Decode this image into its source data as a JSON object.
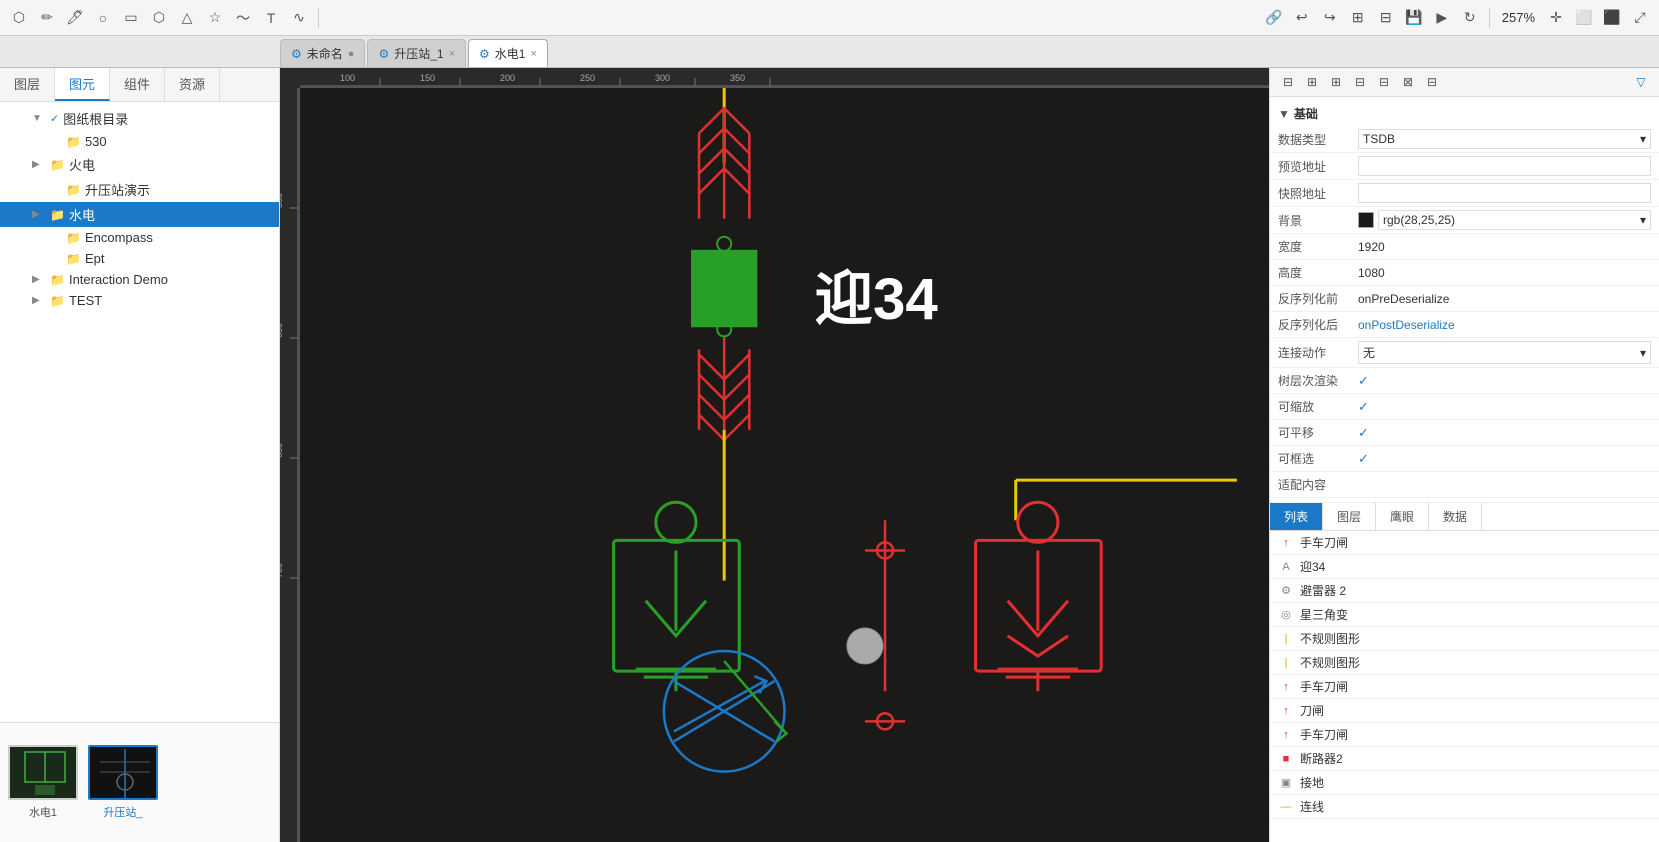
{
  "topToolbar": {
    "icons": [
      "select",
      "pencil",
      "pen",
      "circle",
      "rectangle",
      "hexagon",
      "triangle",
      "star",
      "curve",
      "text",
      "wave"
    ],
    "rightIcons": [
      "link",
      "undo",
      "redo",
      "grid",
      "align",
      "save",
      "play",
      "refresh"
    ],
    "zoom": "257%",
    "moreIcons": [
      "crosshair",
      "window",
      "maxwindow",
      "fullscreen"
    ]
  },
  "tabs": [
    {
      "id": "unnamed",
      "label": "未命名",
      "icon": "⚙",
      "active": false,
      "closable": false
    },
    {
      "id": "substation1",
      "label": "升压站_1",
      "icon": "⚙",
      "active": false,
      "closable": true
    },
    {
      "id": "hydro1",
      "label": "水电1",
      "icon": "⚙",
      "active": true,
      "closable": true
    }
  ],
  "sidebar": {
    "tabs": [
      "图层",
      "图元",
      "组件",
      "资源"
    ],
    "activeTab": "图层",
    "tree": [
      {
        "id": "root",
        "label": "图纸根目录",
        "indent": 0,
        "expand": true,
        "icon": "check",
        "hasCheck": true
      },
      {
        "id": "530",
        "label": "530",
        "indent": 1,
        "icon": "folder"
      },
      {
        "id": "hydro-power",
        "label": "火电",
        "indent": 1,
        "icon": "folder",
        "expand": true
      },
      {
        "id": "substation-demo",
        "label": "升压站演示",
        "indent": 2,
        "icon": "folder"
      },
      {
        "id": "water-power",
        "label": "水电",
        "indent": 1,
        "icon": "folder",
        "active": true
      },
      {
        "id": "encompass",
        "label": "Encompass",
        "indent": 2,
        "icon": "folder"
      },
      {
        "id": "ept",
        "label": "Ept",
        "indent": 2,
        "icon": "folder"
      },
      {
        "id": "interaction-demo",
        "label": "Interaction Demo",
        "indent": 1,
        "icon": "folder",
        "expand": false
      },
      {
        "id": "test",
        "label": "TEST",
        "indent": 1,
        "icon": "folder",
        "expand": false
      }
    ],
    "thumbnails": [
      {
        "id": "thumb1",
        "label": "水电1",
        "active": false
      },
      {
        "id": "thumb2",
        "label": "升压站_",
        "active": true
      }
    ]
  },
  "properties": {
    "sectionLabel": "基础",
    "rows": [
      {
        "key": "dataType",
        "label": "数据类型",
        "value": "TSDB",
        "type": "select"
      },
      {
        "key": "previewUrl",
        "label": "预览地址",
        "value": "",
        "type": "input"
      },
      {
        "key": "snapshotUrl",
        "label": "快照地址",
        "value": "",
        "type": "input"
      },
      {
        "key": "background",
        "label": "背景",
        "value": "rgb(28,25,25)",
        "color": "#1c1919",
        "type": "color-select"
      },
      {
        "key": "width",
        "label": "宽度",
        "value": "1920",
        "type": "text"
      },
      {
        "key": "height",
        "label": "高度",
        "value": "1080",
        "type": "text"
      },
      {
        "key": "preDeserialize",
        "label": "反序列化前",
        "value": "onPreDeserialize",
        "type": "text"
      },
      {
        "key": "postDeserialize",
        "label": "反序列化后",
        "value": "onPostDeserialize",
        "type": "link"
      },
      {
        "key": "connectAction",
        "label": "连接动作",
        "value": "无",
        "type": "select"
      },
      {
        "key": "treeRender",
        "label": "树层次渲染",
        "value": "✓",
        "type": "check"
      },
      {
        "key": "scalable",
        "label": "可缩放",
        "value": "✓",
        "type": "check"
      },
      {
        "key": "pannable",
        "label": "可平移",
        "value": "✓",
        "type": "check"
      },
      {
        "key": "selectable",
        "label": "可框选",
        "value": "✓",
        "type": "check"
      },
      {
        "key": "fitContent",
        "label": "适配内容",
        "value": "",
        "type": "text"
      }
    ]
  },
  "rightPanelTabs": [
    "列表",
    "图层",
    "鹰眼",
    "数据"
  ],
  "activeRightTab": "列表",
  "layerList": [
    {
      "icon": "↑",
      "iconClass": "color-red",
      "label": "手车刀闸"
    },
    {
      "icon": "A",
      "iconClass": "color-gray",
      "label": "迎34"
    },
    {
      "icon": "⚙",
      "iconClass": "color-gray",
      "label": "避雷器 2"
    },
    {
      "icon": "◎",
      "iconClass": "color-gray",
      "label": "星三角变"
    },
    {
      "icon": "|",
      "iconClass": "color-yellow",
      "label": "不规则图形"
    },
    {
      "icon": "|",
      "iconClass": "color-yellow",
      "label": "不规则图形"
    },
    {
      "icon": "↑",
      "iconClass": "color-red",
      "label": "手车刀闸"
    },
    {
      "icon": "↑",
      "iconClass": "color-red",
      "label": "刀闸"
    },
    {
      "icon": "↑",
      "iconClass": "color-red",
      "label": "手车刀闸"
    },
    {
      "icon": "■",
      "iconClass": "color-red",
      "label": "断路器2"
    },
    {
      "icon": "▣",
      "iconClass": "color-gray",
      "label": "接地"
    },
    {
      "icon": "—",
      "iconClass": "color-yellow",
      "label": "连线"
    }
  ],
  "canvasRuler": {
    "hTicks": [
      "100",
      "150",
      "200",
      "250",
      "300",
      "350"
    ],
    "vTicks": [
      "550",
      "600",
      "650",
      "700"
    ]
  }
}
